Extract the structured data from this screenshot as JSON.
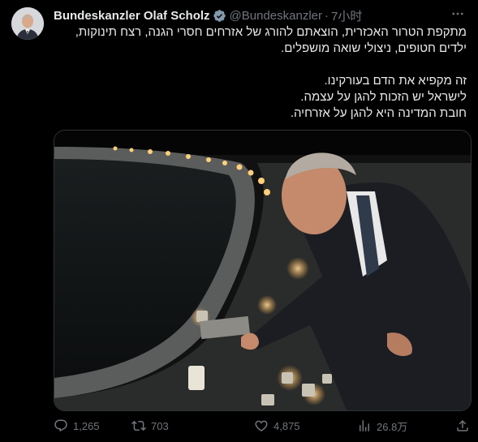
{
  "author": {
    "name": "Bundeskanzler Olaf Scholz",
    "handle": "@Bundeskanzler",
    "time": "7小时",
    "verified": true
  },
  "tweet": {
    "lines": [
      "מתקפת הטרור האכזרית, הוצאתם להורג של אזרחים חסרי הגנה, רצח תינוקות,",
      "ילדים   חטופים, ניצולי שואה מושפלים.",
      "זה מקפיא את הדם בעורקינו.",
      "לישראל יש הזכות להגן על עצמה.",
      "חובת המדינה היא להגן על אזרחיה."
    ]
  },
  "actions": {
    "replies": "1,265",
    "retweets": "703",
    "likes": "4,875",
    "views": "26.8万"
  },
  "colors": {
    "background": "#000000",
    "text": "#e7e9ea",
    "muted": "#71767b",
    "verified": "#829aab"
  }
}
